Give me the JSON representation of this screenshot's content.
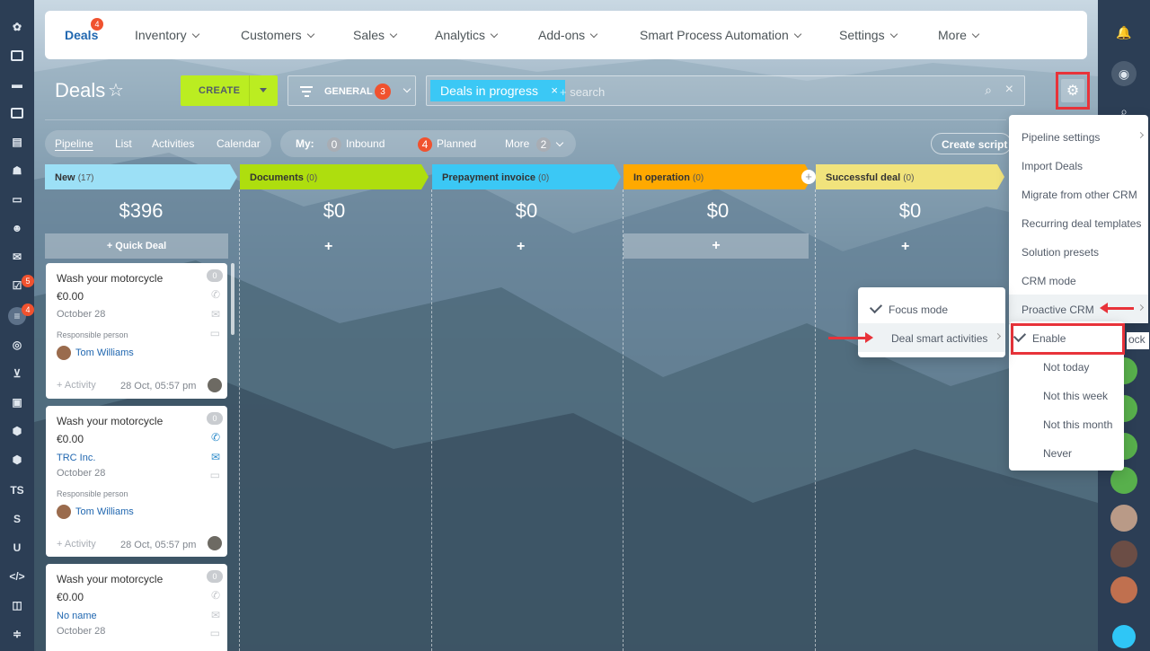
{
  "left_sidebar": {
    "items": [
      "logo",
      "feed",
      "chat",
      "calendar",
      "docs",
      "robot",
      "drive",
      "groups",
      "mail",
      "tasks",
      "crm",
      "target",
      "shop",
      "contacts",
      "box",
      "box2",
      "TS",
      "S",
      "U",
      "code",
      "apps",
      "settings"
    ],
    "tasks_badge": "5",
    "crm_badge": "4"
  },
  "topnav": {
    "items": [
      "Deals",
      "Inventory",
      "Customers",
      "Sales",
      "Analytics",
      "Add-ons",
      "Smart Process Automation",
      "Settings",
      "More"
    ],
    "deals_badge": "4"
  },
  "toolbar": {
    "title": "Deals",
    "create_label": "CREATE",
    "filter_label": "GENERAL",
    "filter_badge": "3",
    "search_tag": "Deals in progress",
    "search_placeholder": "+ search"
  },
  "views": {
    "tabs": [
      "Pipeline",
      "List",
      "Activities",
      "Calendar"
    ],
    "counters_label": "My:",
    "inbound_count": "0",
    "inbound_label": "Inbound",
    "planned_count": "4",
    "planned_label": "Planned",
    "more_label": "More",
    "more_count": "2",
    "create_script": "Create script"
  },
  "stages": [
    {
      "name": "New",
      "count": "(17)",
      "sum": "$396",
      "color": "#9ce0f6"
    },
    {
      "name": "Documents",
      "count": "(0)",
      "sum": "$0",
      "color": "#aede0e"
    },
    {
      "name": "Prepayment invoice",
      "count": "(0)",
      "sum": "$0",
      "color": "#3bc8f5"
    },
    {
      "name": "In operation",
      "count": "(0)",
      "sum": "$0",
      "color": "#ffa900"
    },
    {
      "name": "Successful deal",
      "count": "(0)",
      "sum": "$0",
      "color": "#f1e37c"
    }
  ],
  "quick_deal": "+ Quick Deal",
  "plus": "+",
  "cards": [
    {
      "title": "Wash your motorcycle",
      "count": "0",
      "price": "€0.00",
      "date": "October 28",
      "resp_label": "Responsible person",
      "person": "Tom Williams",
      "activity": "+ Activity",
      "time": "28 Oct, 05:57 pm"
    },
    {
      "title": "Wash your motorcycle",
      "count": "0",
      "price": "€0.00",
      "company": "TRC Inc.",
      "date": "October 28",
      "resp_label": "Responsible person",
      "person": "Tom Williams",
      "activity": "+ Activity",
      "time": "28 Oct, 05:57 pm"
    },
    {
      "title": "Wash your motorcycle",
      "count": "0",
      "price": "€0.00",
      "company": "No name",
      "date": "October 28"
    }
  ],
  "settings_menu": {
    "items": [
      "Pipeline settings",
      "Import Deals",
      "Migrate from other CRM",
      "Recurring deal templates",
      "Solution presets",
      "CRM mode",
      "Proactive CRM"
    ],
    "partial_text": "ock"
  },
  "smart_menu": {
    "items": [
      "Focus mode",
      "Deal smart activities"
    ]
  },
  "proactive_submenu": {
    "items": [
      "Enable",
      "Not today",
      "Not this week",
      "Not this month",
      "Never"
    ]
  },
  "colors": {
    "accent": "#2067b0",
    "create": "#bbed21",
    "badge": "#f0522f",
    "highlight": "#e8333a",
    "sidebar": "#2c3e55"
  }
}
